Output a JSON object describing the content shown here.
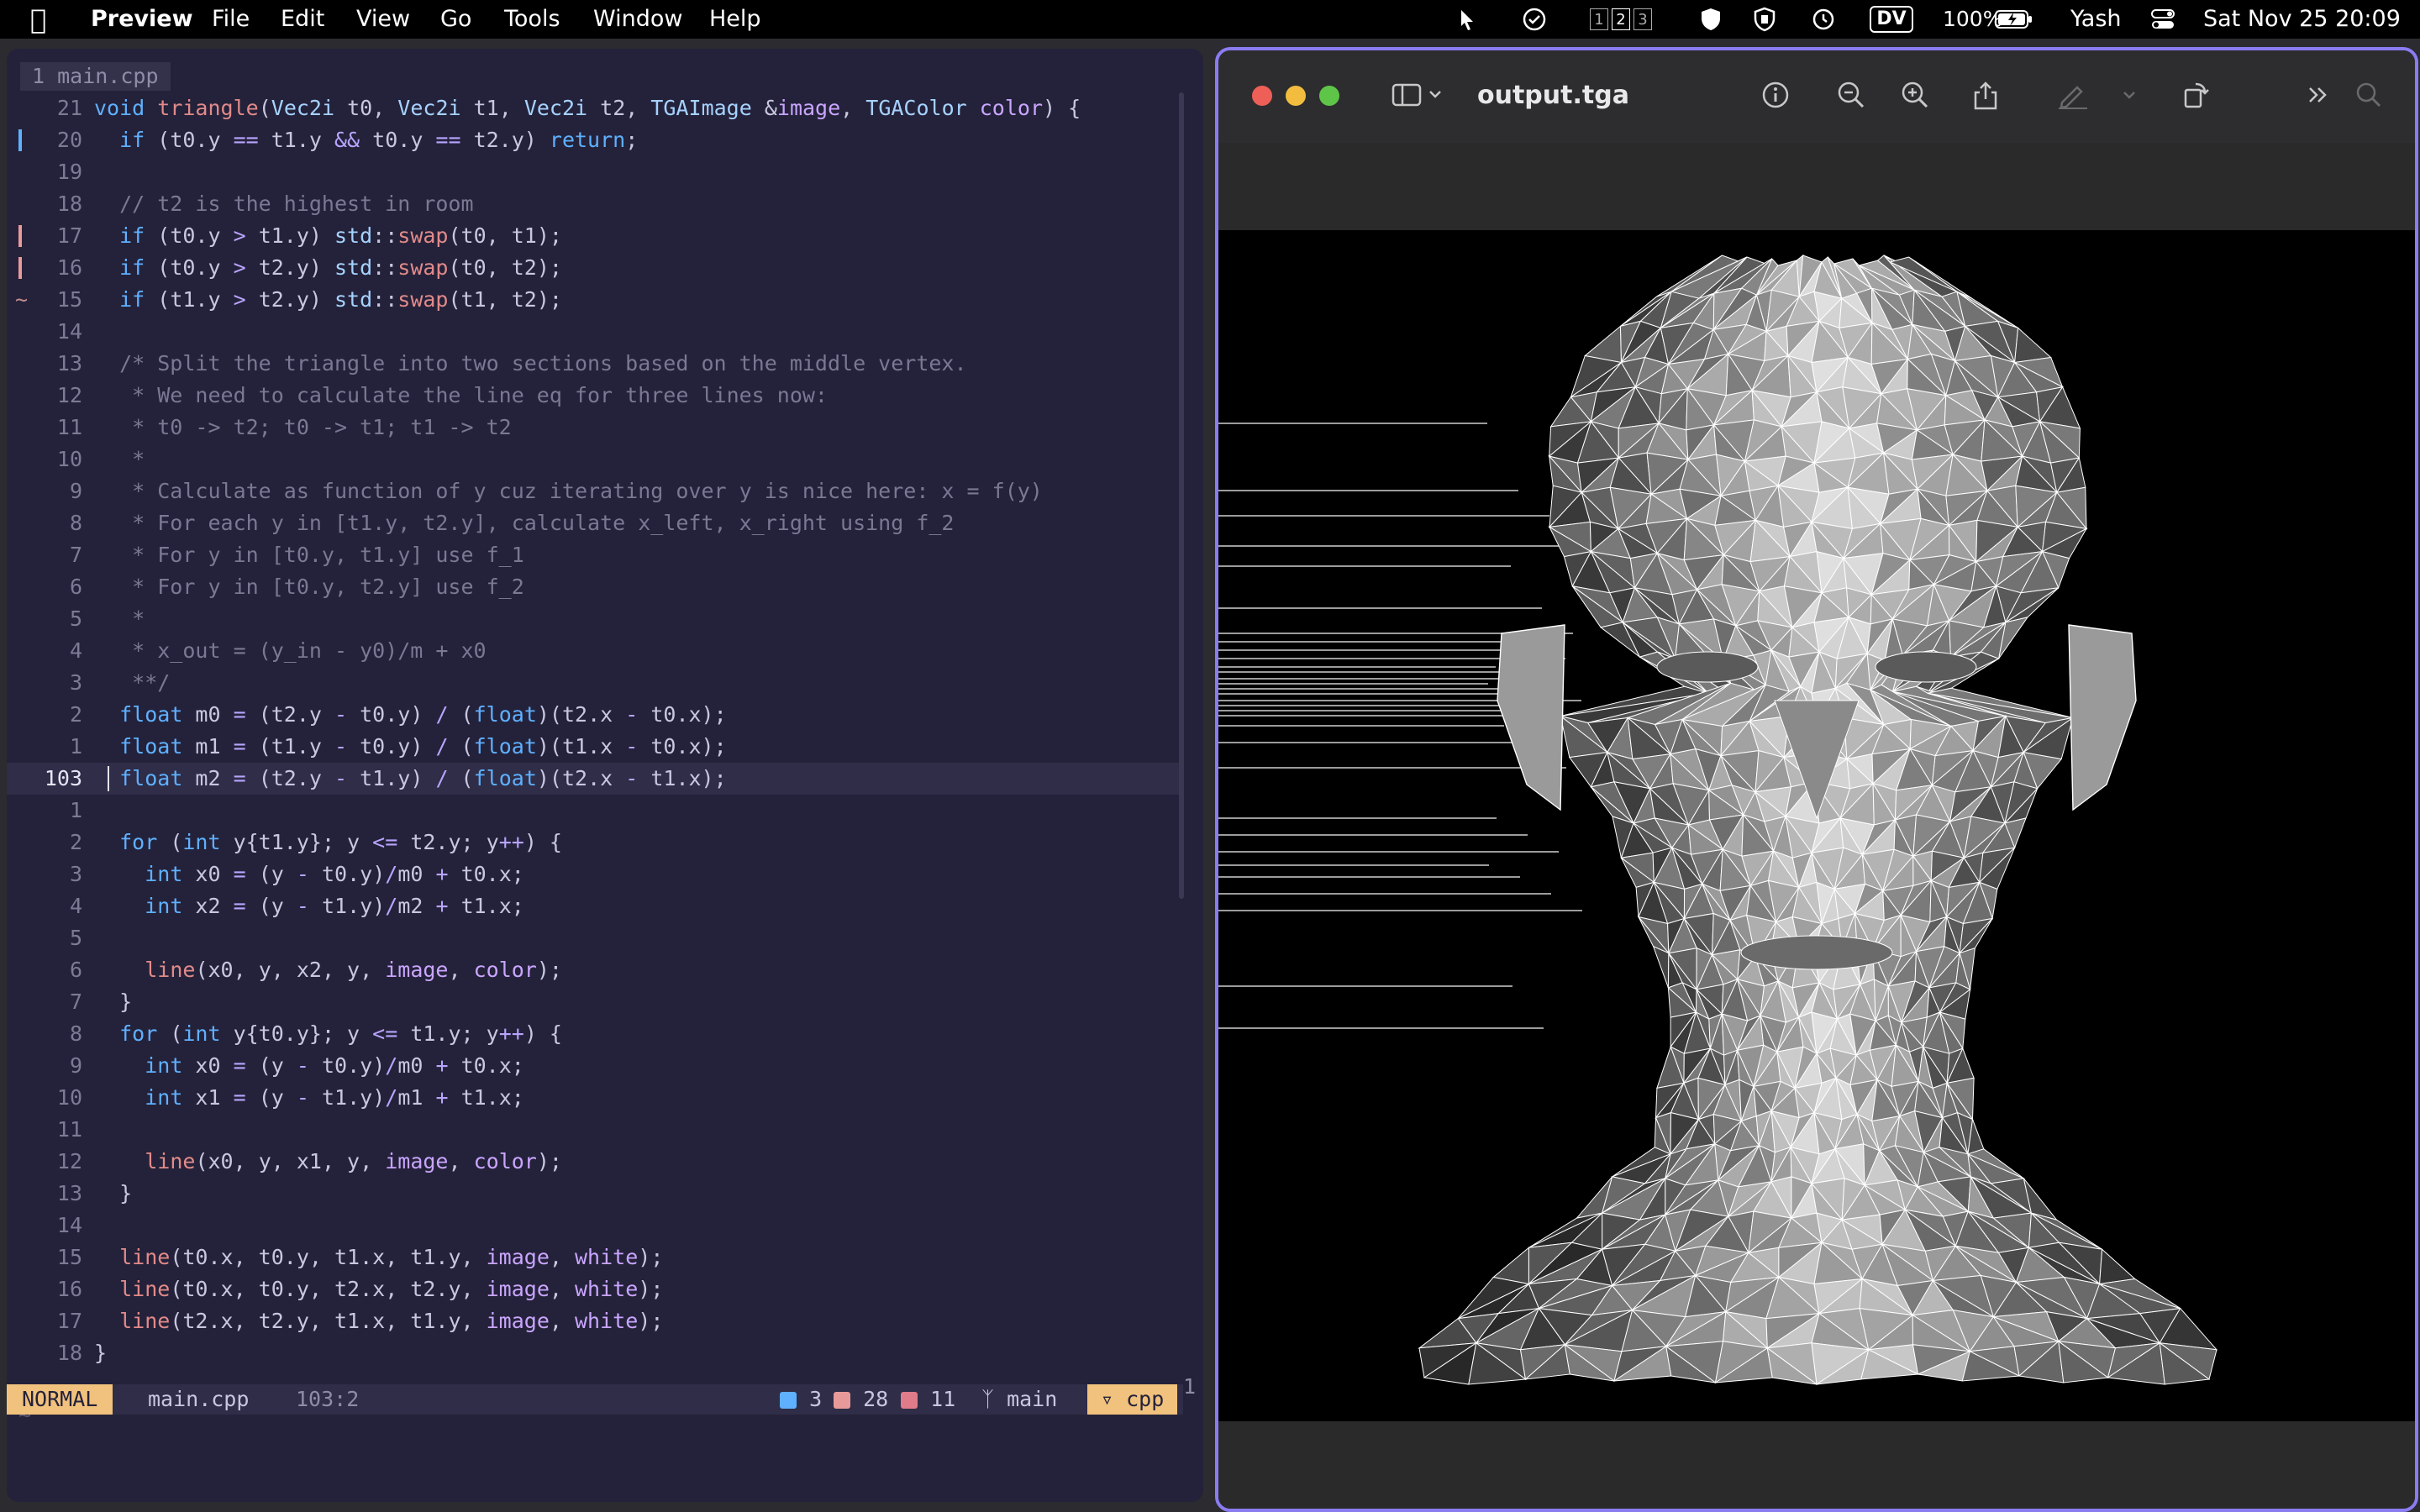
{
  "menubar": {
    "app": "Preview",
    "items": [
      "File",
      "Edit",
      "View",
      "Go",
      "Tools",
      "Window",
      "Help"
    ],
    "spaces": [
      "1",
      "2",
      "3"
    ],
    "dv": "DV",
    "battery": "100%",
    "user": "Yash",
    "datetime": "Sat Nov 25  20:09"
  },
  "editor": {
    "tab": "1 main.cpp",
    "lines": [
      {
        "n": "21",
        "t": "void triangle(Vec2i t0, Vec2i t1, Vec2i t2, TGAImage &image, TGAColor color) {"
      },
      {
        "n": "20",
        "t": "  if (t0.y == t1.y && t0.y == t2.y) return;"
      },
      {
        "n": "19",
        "t": ""
      },
      {
        "n": "18",
        "t": "  // t2 is the highest in room"
      },
      {
        "n": "17",
        "t": "  if (t0.y > t1.y) std::swap(t0, t1);"
      },
      {
        "n": "16",
        "t": "  if (t0.y > t2.y) std::swap(t0, t2);"
      },
      {
        "n": "15",
        "t": "  if (t1.y > t2.y) std::swap(t1, t2);"
      },
      {
        "n": "14",
        "t": ""
      },
      {
        "n": "13",
        "t": "  /* Split the triangle into two sections based on the middle vertex."
      },
      {
        "n": "12",
        "t": "   * We need to calculate the line eq for three lines now:"
      },
      {
        "n": "11",
        "t": "   * t0 -> t2; t0 -> t1; t1 -> t2"
      },
      {
        "n": "10",
        "t": "   *"
      },
      {
        "n": "9",
        "t": "   * Calculate as function of y cuz iterating over y is nice here: x = f(y)"
      },
      {
        "n": "8",
        "t": "   * For each y in [t1.y, t2.y], calculate x_left, x_right using f_2"
      },
      {
        "n": "7",
        "t": "   * For y in [t0.y, t1.y] use f_1"
      },
      {
        "n": "6",
        "t": "   * For y in [t0.y, t2.y] use f_2"
      },
      {
        "n": "5",
        "t": "   *"
      },
      {
        "n": "4",
        "t": "   * x_out = (y_in - y0)/m + x0"
      },
      {
        "n": "3",
        "t": "   **/"
      },
      {
        "n": "2",
        "t": "  float m0 = (t2.y - t0.y) / (float)(t2.x - t0.x);"
      },
      {
        "n": "1",
        "t": "  float m1 = (t1.y - t0.y) / (float)(t1.x - t0.x);"
      },
      {
        "n": "103",
        "t": "  float m2 = (t2.y - t1.y) / (float)(t2.x - t1.x);"
      },
      {
        "n": "1",
        "t": ""
      },
      {
        "n": "2",
        "t": "  for (int y{t1.y}; y <= t2.y; y++) {"
      },
      {
        "n": "3",
        "t": "    int x0 = (y - t0.y)/m0 + t0.x;"
      },
      {
        "n": "4",
        "t": "    int x2 = (y - t1.y)/m2 + t1.x;"
      },
      {
        "n": "5",
        "t": ""
      },
      {
        "n": "6",
        "t": "    line(x0, y, x2, y, image, color);"
      },
      {
        "n": "7",
        "t": "  }"
      },
      {
        "n": "8",
        "t": "  for (int y{t0.y}; y <= t1.y; y++) {"
      },
      {
        "n": "9",
        "t": "    int x0 = (y - t0.y)/m0 + t0.x;"
      },
      {
        "n": "10",
        "t": "    int x1 = (y - t1.y)/m1 + t1.x;"
      },
      {
        "n": "11",
        "t": ""
      },
      {
        "n": "12",
        "t": "    line(x0, y, x1, y, image, color);"
      },
      {
        "n": "13",
        "t": "  }"
      },
      {
        "n": "14",
        "t": ""
      },
      {
        "n": "15",
        "t": "  line(t0.x, t0.y, t1.x, t1.y, image, white);"
      },
      {
        "n": "16",
        "t": "  line(t0.x, t0.y, t2.x, t2.y, image, white);"
      },
      {
        "n": "17",
        "t": "  line(t2.x, t2.y, t1.x, t1.y, image, white);"
      },
      {
        "n": "18",
        "t": "}"
      }
    ],
    "current_line_index": 21,
    "right_indicator": "1",
    "status": {
      "mode": "NORMAL",
      "file": "main.cpp",
      "position": "103:2",
      "added": "3",
      "changed": "28",
      "removed": "11",
      "branch": "main",
      "filetype": "cpp"
    }
  },
  "preview": {
    "title": "output.tga",
    "image_desc_icon": "wireframe-head-icon"
  },
  "colors": {
    "accent": "#8a7cf0",
    "status_mode": "#f1c27d"
  }
}
